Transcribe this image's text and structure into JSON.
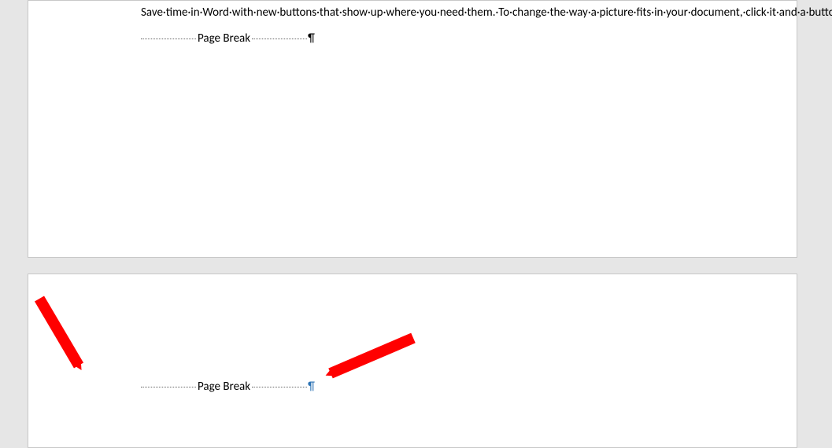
{
  "page1": {
    "paragraph": "Save·time·in·Word·with·new·buttons·that·show·up·where·you·need·them.·To·change·the·way·a·picture·fits·in·your·document,·click·it·and·a·button·for·layout·options·appears·next·to·it.·When·you·work·on·a·table,·click·where·you·want·to·add·a·row·or·a·column,·and·then·click·the·plus·sign.¶",
    "page_break_label": "Page Break",
    "page_break_pilcrow": "¶"
  },
  "page2": {
    "page_break_label": "Page Break",
    "page_break_pilcrow": "¶"
  }
}
